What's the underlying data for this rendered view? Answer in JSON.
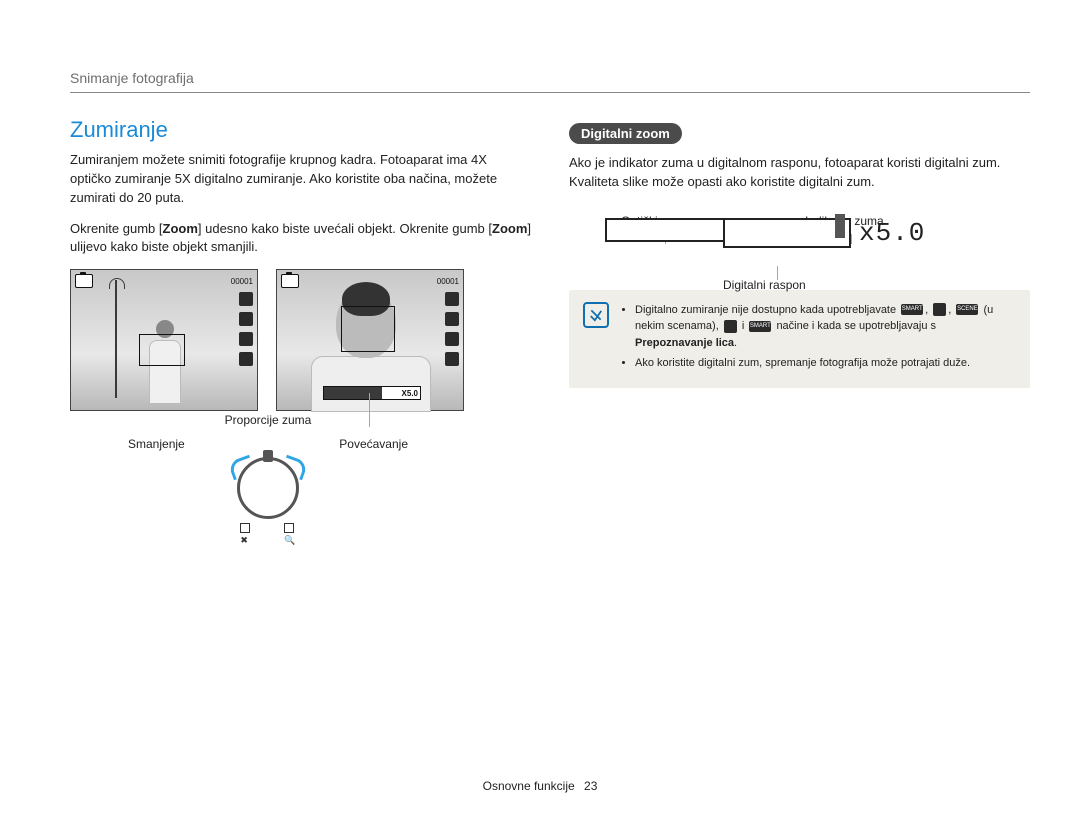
{
  "header": {
    "breadcrumb": "Snimanje fotografija"
  },
  "left": {
    "title": "Zumiranje",
    "p1": "Zumiranjem možete snimiti fotografije krupnog kadra. Fotoaparat ima 4X optičko zumiranje 5X digitalno zumiranje. Ako koristite oba načina, možete zumirati do 20 puta.",
    "p2a": "Okrenite gumb [",
    "p2b": "Zoom",
    "p2c": "] udesno kako biste uvećali objekt. Okrenite gumb [",
    "p2d": "Zoom",
    "p2e": "] ulijevo kako biste objekt smanjili.",
    "shot_counter": "00001",
    "zoom_badge": "X5.0",
    "annot_ratio": "Proporcije zuma",
    "annot_dec": "Smanjenje",
    "annot_inc": "Povećavanje"
  },
  "right": {
    "pill": "Digitalni zoom",
    "p1": "Ako je indikator zuma u digitalnom rasponu, fotoaparat koristi digitalni zum. Kvaliteta slike može opasti ako koristite digitalni zum.",
    "lab_optical": "Optički raspon",
    "lab_indicator": "Indikator zuma",
    "lab_digital": "Digitalni raspon",
    "zoom_value": "x5.0",
    "note": {
      "li1a": "Digitalno zumiranje nije dostupno kada upotrebljavate ",
      "li1b": " (u nekim scenama), ",
      "li1c": " i ",
      "li1d": " načine i kada se upotrebljavaju s ",
      "li1e": "Prepoznavanje lica",
      "li1f": ".",
      "li2": "Ako koristite digitalni zum, spremanje fotografija može potrajati duže.",
      "ico_smart": "SMART",
      "ico_scene": "SCENE"
    }
  },
  "footer": {
    "section": "Osnovne funkcije",
    "page": "23"
  }
}
